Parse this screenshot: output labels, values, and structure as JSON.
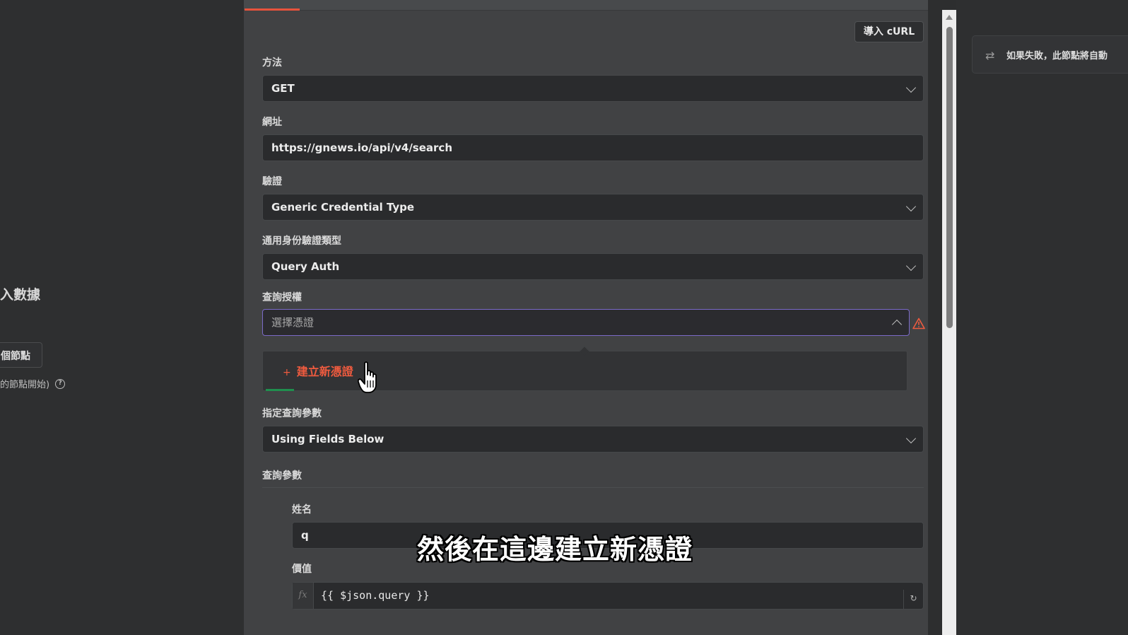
{
  "left_pane": {
    "title_fragment": "入數據",
    "button_fragment": "個節點",
    "hint_fragment": "的節點開始)"
  },
  "panel": {
    "import_curl_label": "導入 cURL",
    "method": {
      "label": "方法",
      "value": "GET"
    },
    "url": {
      "label": "網址",
      "value": "https://gnews.io/api/v4/search"
    },
    "authentication": {
      "label": "驗證",
      "value": "Generic Credential Type"
    },
    "generic_auth_type": {
      "label": "通用身份驗證類型",
      "value": "Query Auth"
    },
    "query_auth": {
      "label": "查詢授權",
      "placeholder": "選擇憑證"
    },
    "dropdown": {
      "create_label": "建立新憑證",
      "plus": "+"
    },
    "specify_query_params": {
      "label": "指定查詢參數",
      "value": "Using Fields Below"
    },
    "query_params": {
      "label": "查詢參數",
      "name": {
        "label": "姓名",
        "value": "q"
      },
      "value": {
        "label": "價值",
        "expression": "{{ $json.query }}",
        "fx": "fx"
      }
    }
  },
  "right_pane": {
    "retry_text": "如果失敗，此節點將自動"
  },
  "subtitle": "然後在這邊建立新憑證",
  "colors": {
    "accent": "#e8533c",
    "focus_border": "#7b6ac8",
    "warning": "#ef5b3f"
  }
}
